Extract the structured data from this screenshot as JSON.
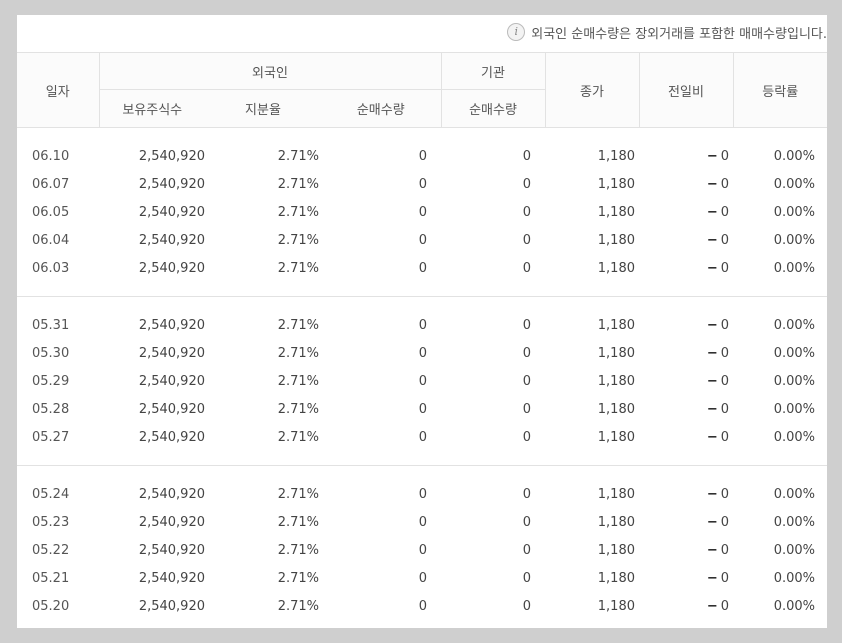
{
  "notice": {
    "icon": "info-icon",
    "text": "외국인 순매수량은 장외거래를 포함한 매매수량입니다."
  },
  "header": {
    "date": "일자",
    "foreign": "외국인",
    "institution": "기관",
    "close": "종가",
    "change": "전일비",
    "rate": "등락률",
    "holdings": "보유주식수",
    "share": "지분율",
    "foreign_net": "순매수량",
    "inst_net": "순매수량"
  },
  "groups": [
    {
      "rows": [
        {
          "date": "06.10",
          "holdings": "2,540,920",
          "share": "2.71%",
          "foreign_net": "0",
          "inst_net": "0",
          "close": "1,180",
          "change_symbol": "−",
          "change": "0",
          "rate": "0.00%"
        },
        {
          "date": "06.07",
          "holdings": "2,540,920",
          "share": "2.71%",
          "foreign_net": "0",
          "inst_net": "0",
          "close": "1,180",
          "change_symbol": "−",
          "change": "0",
          "rate": "0.00%"
        },
        {
          "date": "06.05",
          "holdings": "2,540,920",
          "share": "2.71%",
          "foreign_net": "0",
          "inst_net": "0",
          "close": "1,180",
          "change_symbol": "−",
          "change": "0",
          "rate": "0.00%"
        },
        {
          "date": "06.04",
          "holdings": "2,540,920",
          "share": "2.71%",
          "foreign_net": "0",
          "inst_net": "0",
          "close": "1,180",
          "change_symbol": "−",
          "change": "0",
          "rate": "0.00%"
        },
        {
          "date": "06.03",
          "holdings": "2,540,920",
          "share": "2.71%",
          "foreign_net": "0",
          "inst_net": "0",
          "close": "1,180",
          "change_symbol": "−",
          "change": "0",
          "rate": "0.00%"
        }
      ]
    },
    {
      "rows": [
        {
          "date": "05.31",
          "holdings": "2,540,920",
          "share": "2.71%",
          "foreign_net": "0",
          "inst_net": "0",
          "close": "1,180",
          "change_symbol": "−",
          "change": "0",
          "rate": "0.00%"
        },
        {
          "date": "05.30",
          "holdings": "2,540,920",
          "share": "2.71%",
          "foreign_net": "0",
          "inst_net": "0",
          "close": "1,180",
          "change_symbol": "−",
          "change": "0",
          "rate": "0.00%"
        },
        {
          "date": "05.29",
          "holdings": "2,540,920",
          "share": "2.71%",
          "foreign_net": "0",
          "inst_net": "0",
          "close": "1,180",
          "change_symbol": "−",
          "change": "0",
          "rate": "0.00%"
        },
        {
          "date": "05.28",
          "holdings": "2,540,920",
          "share": "2.71%",
          "foreign_net": "0",
          "inst_net": "0",
          "close": "1,180",
          "change_symbol": "−",
          "change": "0",
          "rate": "0.00%"
        },
        {
          "date": "05.27",
          "holdings": "2,540,920",
          "share": "2.71%",
          "foreign_net": "0",
          "inst_net": "0",
          "close": "1,180",
          "change_symbol": "−",
          "change": "0",
          "rate": "0.00%"
        }
      ]
    },
    {
      "rows": [
        {
          "date": "05.24",
          "holdings": "2,540,920",
          "share": "2.71%",
          "foreign_net": "0",
          "inst_net": "0",
          "close": "1,180",
          "change_symbol": "−",
          "change": "0",
          "rate": "0.00%"
        },
        {
          "date": "05.23",
          "holdings": "2,540,920",
          "share": "2.71%",
          "foreign_net": "0",
          "inst_net": "0",
          "close": "1,180",
          "change_symbol": "−",
          "change": "0",
          "rate": "0.00%"
        },
        {
          "date": "05.22",
          "holdings": "2,540,920",
          "share": "2.71%",
          "foreign_net": "0",
          "inst_net": "0",
          "close": "1,180",
          "change_symbol": "−",
          "change": "0",
          "rate": "0.00%"
        },
        {
          "date": "05.21",
          "holdings": "2,540,920",
          "share": "2.71%",
          "foreign_net": "0",
          "inst_net": "0",
          "close": "1,180",
          "change_symbol": "−",
          "change": "0",
          "rate": "0.00%"
        },
        {
          "date": "05.20",
          "holdings": "2,540,920",
          "share": "2.71%",
          "foreign_net": "0",
          "inst_net": "0",
          "close": "1,180",
          "change_symbol": "−",
          "change": "0",
          "rate": "0.00%"
        }
      ]
    }
  ]
}
